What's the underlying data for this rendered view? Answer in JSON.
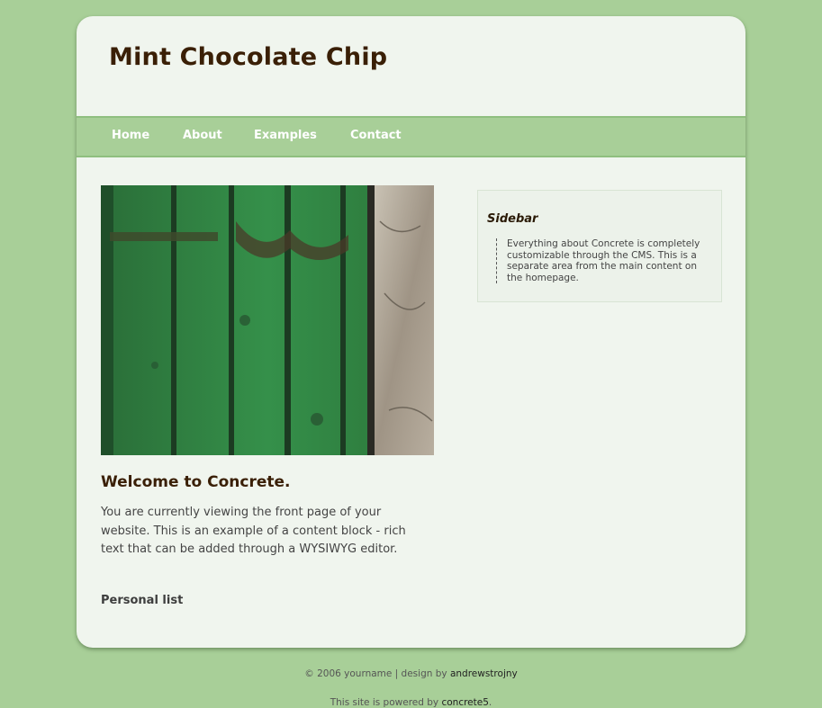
{
  "header": {
    "site_title": "Mint Chocolate Chip"
  },
  "nav": {
    "items": [
      {
        "label": "Home"
      },
      {
        "label": "About"
      },
      {
        "label": "Examples"
      },
      {
        "label": "Contact"
      }
    ]
  },
  "main": {
    "heading": "Welcome to Concrete.",
    "body": "You are currently viewing the front page of your website. This is an example of a content block - rich text that can be added through a WYSIWYG editor.",
    "personal_list": "Personal list"
  },
  "sidebar": {
    "title": "Sidebar",
    "text": "Everything about Concrete is completely customizable through the CMS. This is a separate area from the main content on the homepage."
  },
  "footer": {
    "copyright": "© 2006 yourname | design by ",
    "designer_link": "andrewstrojny",
    "powered_prefix": "This site is powered by ",
    "powered_link": "concrete5",
    "powered_suffix": "."
  },
  "colors": {
    "page_background": "#a8cf98",
    "card_background": "#f0f5ee",
    "title_color": "#3a1f06",
    "nav_background": "#a8cf98"
  }
}
